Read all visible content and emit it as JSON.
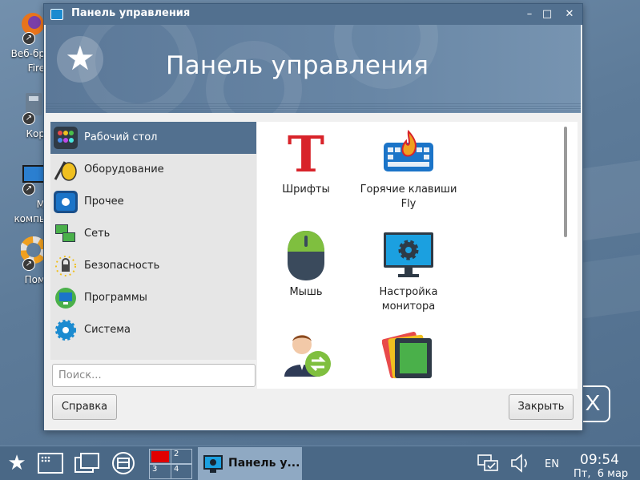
{
  "desktop": {
    "icons": [
      {
        "label": "Веб-бр",
        "label2": "Fire",
        "color": "#e8741c"
      },
      {
        "label": "Кор",
        "color": "#6b7f93"
      },
      {
        "label": "М",
        "label2": "компь",
        "color": "#2b7fd0"
      },
      {
        "label": "Пом",
        "color": "#f0a020"
      }
    ],
    "logo": "X"
  },
  "window": {
    "title": "Панель управления",
    "banner_title": "Панель управления",
    "controls": {
      "minimize": "–",
      "maximize": "□",
      "close": "✕"
    }
  },
  "sidebar": {
    "items": [
      {
        "label": "Рабочий стол",
        "icon": "desktop-icon",
        "active": true
      },
      {
        "label": "Оборудование",
        "icon": "hardware-icon",
        "active": false
      },
      {
        "label": "Прочее",
        "icon": "misc-icon",
        "active": false
      },
      {
        "label": "Сеть",
        "icon": "network-icon",
        "active": false
      },
      {
        "label": "Безопасность",
        "icon": "security-icon",
        "active": false
      },
      {
        "label": "Программы",
        "icon": "programs-icon",
        "active": false
      },
      {
        "label": "Система",
        "icon": "system-icon",
        "active": false
      }
    ]
  },
  "search": {
    "placeholder": "Поиск...",
    "value": ""
  },
  "buttons": {
    "help": "Справка",
    "close": "Закрыть"
  },
  "apps": [
    {
      "label": "Шрифты",
      "icon": "fonts-icon"
    },
    {
      "label": "Горячие клавиши",
      "label2": "Fly",
      "icon": "hotkeys-icon"
    },
    {
      "label": "Мышь",
      "icon": "mouse-icon"
    },
    {
      "label": "Настройка",
      "label2": "монитора",
      "icon": "monitor-icon"
    },
    {
      "label": "",
      "icon": "user-switch-icon"
    },
    {
      "label": "",
      "icon": "theme-icon"
    }
  ],
  "taskbar": {
    "workspaces": [
      "1",
      "2",
      "3",
      "4"
    ],
    "task_label": "Панель у...",
    "language": "EN",
    "time": "09:54",
    "date": "Пт,  6 мар"
  },
  "colors": {
    "accent": "#52708f",
    "taskbar": "#4a6886"
  }
}
